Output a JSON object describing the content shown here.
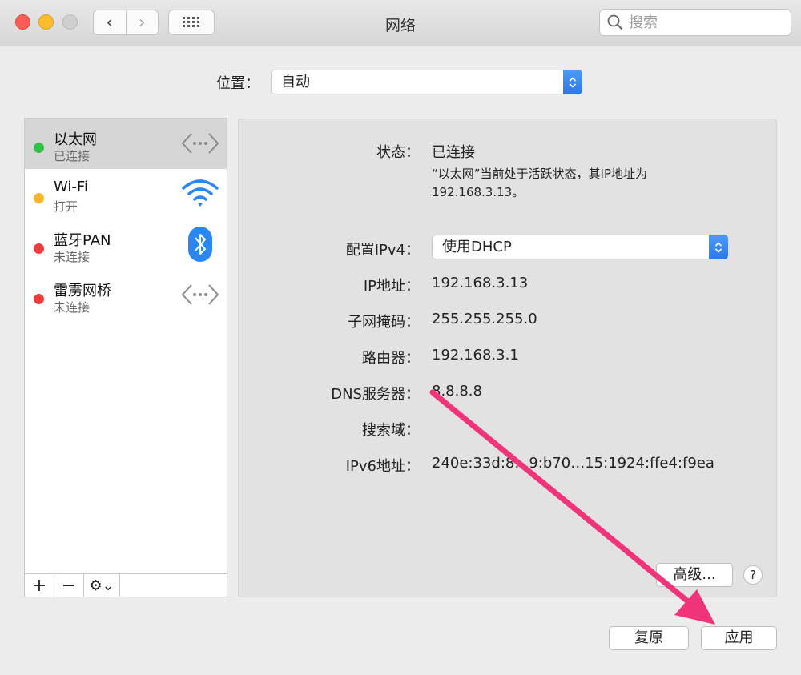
{
  "window": {
    "title": "网络",
    "search_placeholder": "搜索"
  },
  "location": {
    "label": "位置：",
    "value": "自动"
  },
  "services": [
    {
      "name": "以太网",
      "status": "已连接",
      "dot_color": "#2fc448",
      "icon": "ethernet-icon"
    },
    {
      "name": "Wi-Fi",
      "status": "打开",
      "dot_color": "#fcb62c",
      "icon": "wifi-icon"
    },
    {
      "name": "蓝牙PAN",
      "status": "未连接",
      "dot_color": "#f03c3c",
      "icon": "bluetooth-icon"
    },
    {
      "name": "雷雳网桥",
      "status": "未连接",
      "dot_color": "#f03c3c",
      "icon": "thunderbolt-bridge-icon"
    }
  ],
  "sidebar_toolbar": {
    "add": "+",
    "remove": "−",
    "action": "⚙︎⌄"
  },
  "details": {
    "status_label": "状态：",
    "status_value": "已连接",
    "status_desc": "“以太网”当前处于活跃状态，其IP地址为192.168.3.13。",
    "config_label": "配置IPv4：",
    "config_value": "使用DHCP",
    "ip_label": "IP地址：",
    "ip_value": "192.168.3.13",
    "subnet_label": "子网掩码：",
    "subnet_value": "255.255.255.0",
    "router_label": "路由器：",
    "router_value": "192.168.3.1",
    "dns_label": "DNS服务器：",
    "dns_value": "8.8.8.8",
    "search_domain_label": "搜索域：",
    "ipv6_label": "IPv6地址：",
    "ipv6_value": "240e:33d:8…9:b70…15:1924:ffe4:f9ea"
  },
  "buttons": {
    "advanced": "高级...",
    "help": "?",
    "revert": "复原",
    "apply": "应用"
  },
  "colors": {
    "accent": "#2a78e8",
    "annotation_arrow": "#f0347a"
  }
}
